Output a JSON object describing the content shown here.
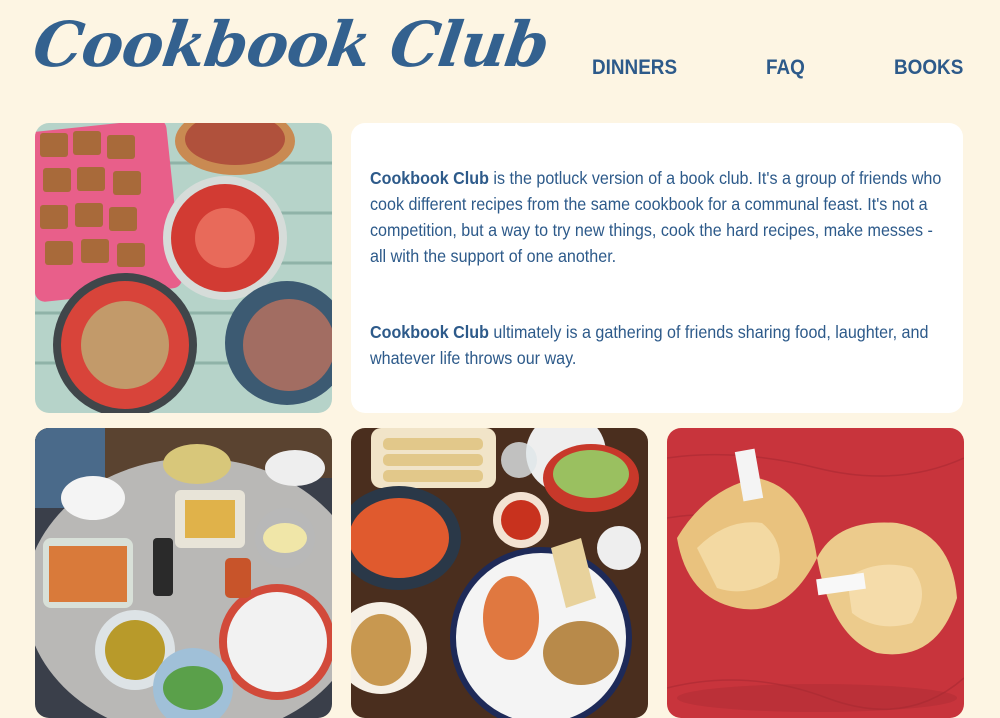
{
  "site": {
    "logo": "Cookbook Club"
  },
  "nav": {
    "dinners": "DINNERS",
    "faq": "FAQ",
    "books": "BOOKS"
  },
  "about": {
    "p1_bold": "Cookbook Club",
    "p1_rest": " is the potluck version of a book club. It's a group of friends who cook different recipes from the same cookbook for a communal feast. It's not a competition, but a way to try new things, cook the hard recipes, make messes - all with the support of one another.",
    "p2_bold": "Cookbook Club",
    "p2_rest": " ultimately is a gathering of friends sharing food, laughter, and whatever life throws our way."
  },
  "photos": [
    "pie-table-photo",
    "dinner-table-photo",
    "tamales-photo",
    "fortune-cookies-photo"
  ]
}
